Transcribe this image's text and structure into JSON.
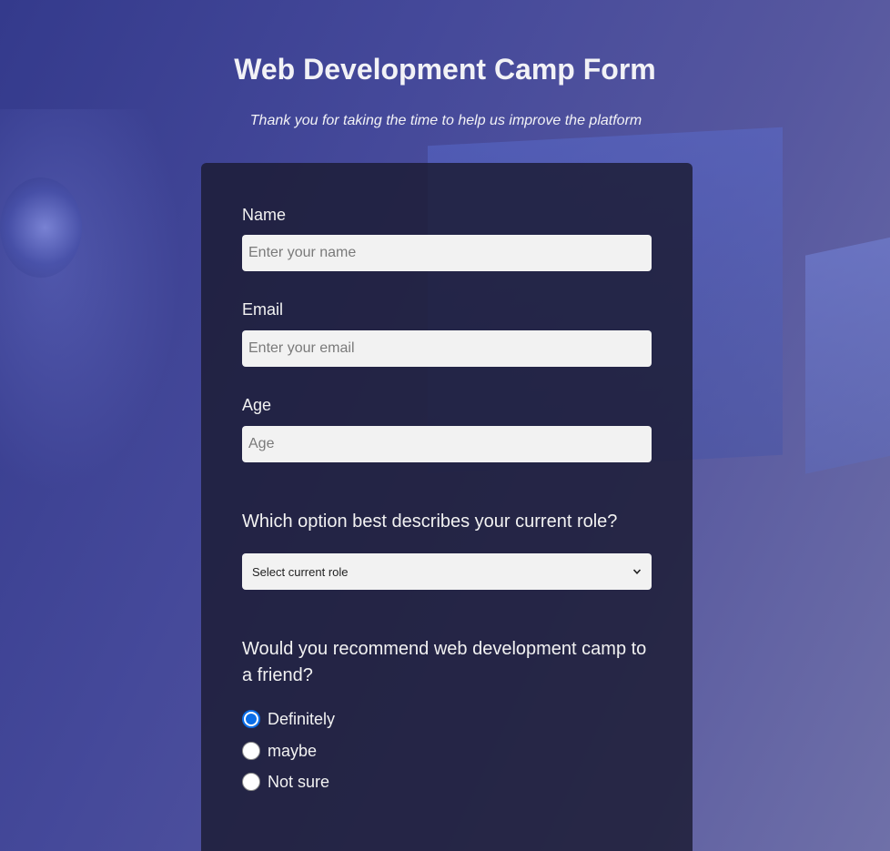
{
  "header": {
    "title": "Web Development Camp Form",
    "subtitle": "Thank you for taking the time to help us improve the platform"
  },
  "form": {
    "name": {
      "label": "Name",
      "placeholder": "Enter your name",
      "value": ""
    },
    "email": {
      "label": "Email",
      "placeholder": "Enter your email",
      "value": ""
    },
    "age": {
      "label": "Age",
      "placeholder": "Age",
      "value": ""
    },
    "role": {
      "question": "Which option best describes your current role?",
      "selected": "Select current role",
      "icon": "chevron-down-icon"
    },
    "recommend": {
      "question": "Would you recommend web development camp to a friend?",
      "options": [
        {
          "label": "Definitely",
          "checked": true
        },
        {
          "label": "maybe",
          "checked": false
        },
        {
          "label": "Not sure",
          "checked": false
        }
      ]
    }
  },
  "colors": {
    "accent": "#0b6ee8",
    "card": "#1b1b32",
    "background_start": "#343a8c",
    "background_end": "#6f70a8"
  }
}
